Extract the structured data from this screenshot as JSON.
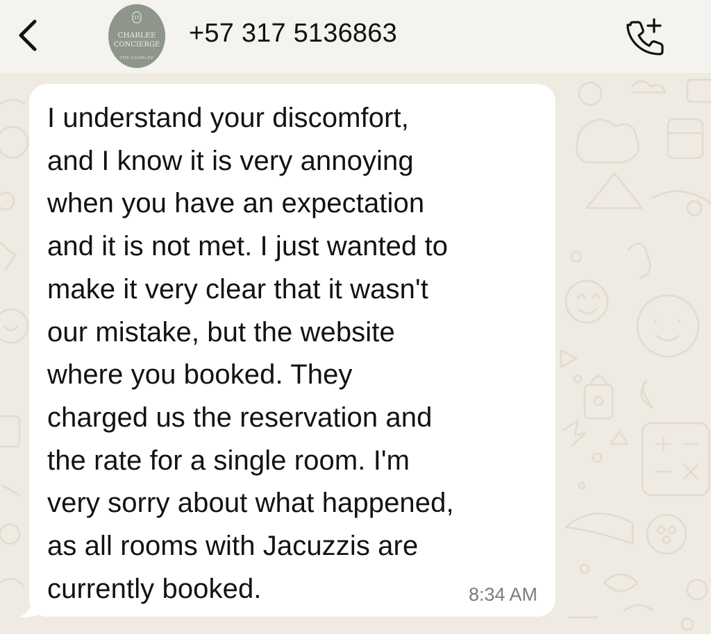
{
  "header": {
    "back_icon": "chevron-left-icon",
    "avatar": {
      "line1": "CHARLEE",
      "line2": "CONCIERGE",
      "line3": "THE CHARLEE"
    },
    "contact_number": "+57 317 5136863",
    "call_icon": "phone-plus-icon"
  },
  "chat": {
    "wallpaper": "doodle-pattern",
    "message": {
      "text": "I understand your discomfort,\nand I know it is very annoying\nwhen you have an expectation\nand it is not met. I just wanted to\nmake it very clear that it wasn't\nour mistake, but the website\nwhere you booked. They\ncharged us the reservation and\nthe rate for a single room. I'm\nvery sorry about what happened,\nas all rooms with Jacuzzis are\ncurrently booked.",
      "time": "8:34 AM"
    }
  },
  "colors": {
    "wallpaper": "#efeae2",
    "doodle": "#e1dbcf",
    "header": "#f5f3ef",
    "bubble": "#ffffff",
    "avatar": "#8e968c",
    "text": "#121212",
    "timestamp": "#7b7b7b"
  }
}
